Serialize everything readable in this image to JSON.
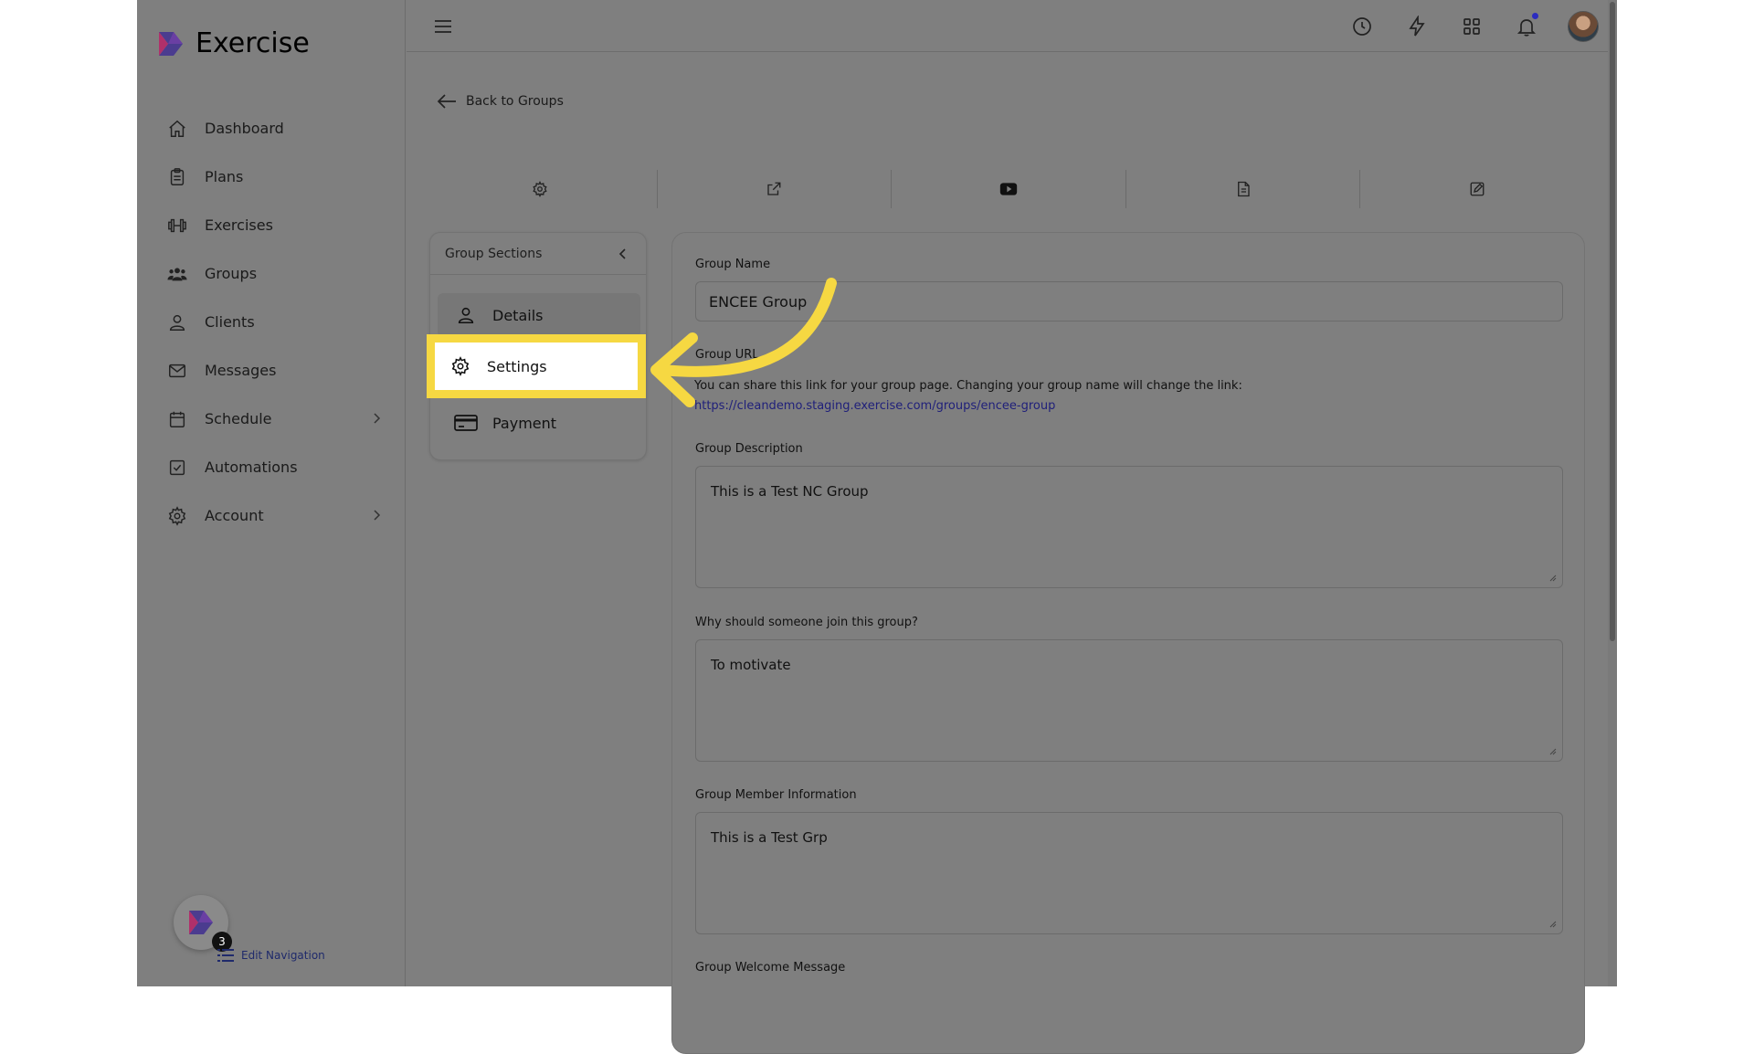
{
  "brand": {
    "name": "Exercise"
  },
  "nav": {
    "items": [
      {
        "label": "Dashboard",
        "icon": "home-icon"
      },
      {
        "label": "Plans",
        "icon": "clipboard-icon"
      },
      {
        "label": "Exercises",
        "icon": "dumbbell-icon"
      },
      {
        "label": "Groups",
        "icon": "users-icon"
      },
      {
        "label": "Clients",
        "icon": "user-icon"
      },
      {
        "label": "Messages",
        "icon": "mail-icon"
      },
      {
        "label": "Schedule",
        "icon": "calendar-icon",
        "has_submenu": true
      },
      {
        "label": "Automations",
        "icon": "check-square-icon"
      },
      {
        "label": "Account",
        "icon": "gear-icon",
        "has_submenu": true
      }
    ]
  },
  "footer": {
    "badge_count": "3",
    "edit_nav_label": "Edit Navigation"
  },
  "topbar": {
    "icons": [
      "history-icon",
      "lightning-icon",
      "apps-grid-icon",
      "bell-icon",
      "avatar"
    ]
  },
  "main": {
    "back_label": "Back to Groups",
    "tabs": [
      "gear-icon",
      "external-link-icon",
      "video-icon",
      "document-icon",
      "edit-icon"
    ],
    "sections": {
      "title": "Group Sections",
      "items": [
        {
          "label": "Details",
          "icon": "user-icon"
        },
        {
          "label": "Settings",
          "icon": "gear-icon",
          "highlighted": true
        },
        {
          "label": "Payment",
          "icon": "credit-card-icon"
        }
      ]
    },
    "form": {
      "group_name_label": "Group Name",
      "group_name_value": "ENCEE Group",
      "group_url_label": "Group URL",
      "group_url_help": "You can share this link for your group page. Changing your group name will change the link: ",
      "group_url_link": "https://cleandemo.staging.exercise.com/groups/encee-group",
      "description_label": "Group Description",
      "description_value": "This is a Test NC Group",
      "why_join_label": "Why should someone join this group?",
      "why_join_value": "To motivate",
      "member_info_label": "Group Member Information",
      "member_info_value": "This is a Test Grp",
      "welcome_label": "Group Welcome Message"
    }
  },
  "colors": {
    "highlight": "#f6d842",
    "overlay": "#7f7f7f",
    "link": "#20207a"
  }
}
